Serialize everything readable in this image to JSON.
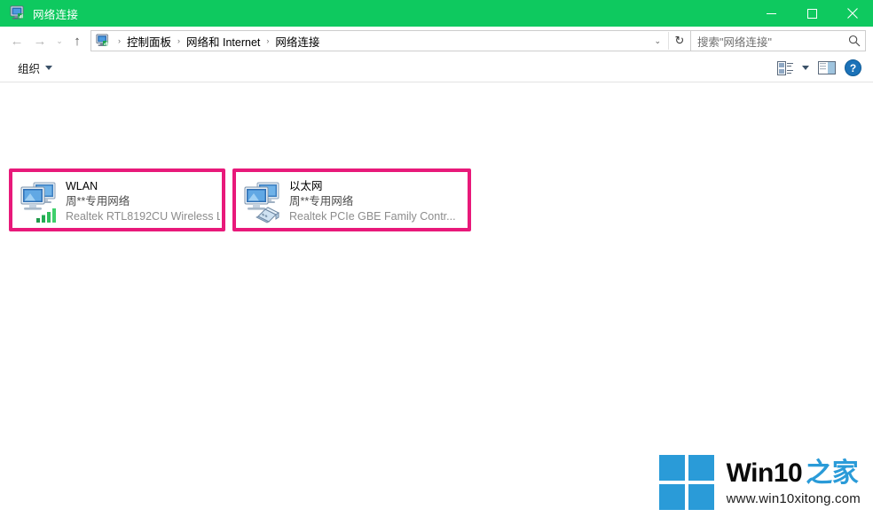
{
  "window": {
    "title": "网络连接",
    "icon": "network-connections-icon",
    "titlebar_color": "#0ec95f",
    "controls": [
      {
        "name": "minimize-button",
        "glyph": "—"
      },
      {
        "name": "maximize-button",
        "glyph": "□"
      },
      {
        "name": "close-button",
        "glyph": "✕"
      }
    ]
  },
  "addressbar": {
    "back_label": "←",
    "forward_label": "→",
    "recent_label": "⌄",
    "up_label": "↑",
    "crumb_icon": "network-connections-icon",
    "crumbs": [
      {
        "label": "控制面板"
      },
      {
        "label": "网络和 Internet"
      },
      {
        "label": "网络连接"
      }
    ],
    "separator": "›",
    "dropdown_glyph": "⌄",
    "refresh_glyph": "↻"
  },
  "search": {
    "placeholder": "搜索\"网络连接\"",
    "value": "",
    "icon": "search-icon"
  },
  "toolbar": {
    "organize_label": "组织",
    "view_icon": "view-layout-icon",
    "view_dropdown_icon": "chevron-down-icon",
    "preview_pane_icon": "preview-pane-icon",
    "help_icon": "help-icon",
    "help_glyph": "?"
  },
  "connections": [
    {
      "id": "wlan",
      "name": "WLAN",
      "network": "周**专用网络",
      "device": "Realtek RTL8192CU Wireless L",
      "icon": "wireless-network-icon",
      "highlighted": true
    },
    {
      "id": "ethernet",
      "name": "以太网",
      "network": "周**专用网络",
      "device": "Realtek PCIe GBE Family Contr...",
      "icon": "ethernet-network-icon",
      "highlighted": true
    }
  ],
  "highlight": {
    "color": "#e8197a"
  },
  "watermark": {
    "brand": "Win10",
    "brand_suffix": "之家",
    "url": "www.win10xitong.com",
    "logo": "windows-logo",
    "accent_color": "#2a9bd8"
  }
}
